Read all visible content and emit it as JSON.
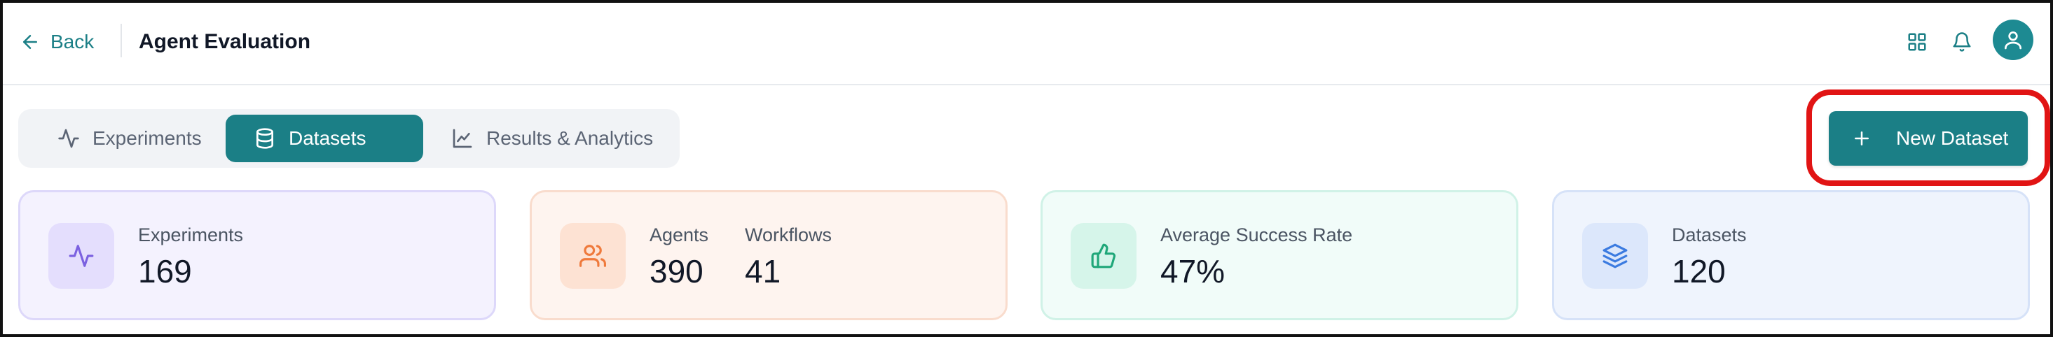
{
  "header": {
    "back_label": "Back",
    "title": "Agent Evaluation",
    "icons": [
      "grid-icon",
      "bell-icon",
      "user-icon"
    ]
  },
  "tabs": [
    {
      "label": "Experiments",
      "icon": "activity-icon",
      "active": false
    },
    {
      "label": "Datasets",
      "icon": "database-icon",
      "active": true
    },
    {
      "label": "Results & Analytics",
      "icon": "line-chart-icon",
      "active": false
    }
  ],
  "actions": {
    "new_dataset_label": "New Dataset"
  },
  "cards": {
    "experiments": {
      "label": "Experiments",
      "value": "169",
      "icon": "activity-icon"
    },
    "agents": {
      "label": "Agents",
      "value": "390",
      "icon": "users-icon"
    },
    "workflows": {
      "label": "Workflows",
      "value": "41"
    },
    "success": {
      "label": "Average Success Rate",
      "value": "47%",
      "icon": "thumbs-up-icon"
    },
    "datasets": {
      "label": "Datasets",
      "value": "120",
      "icon": "layers-icon"
    }
  },
  "colors": {
    "accent": "#1b7f86",
    "highlight": "#e11414",
    "card_purple_bg": "#f4f2fe",
    "card_orange_bg": "#fef4ef",
    "card_green_bg": "#f1fcf9",
    "card_blue_bg": "#eff4fd"
  }
}
